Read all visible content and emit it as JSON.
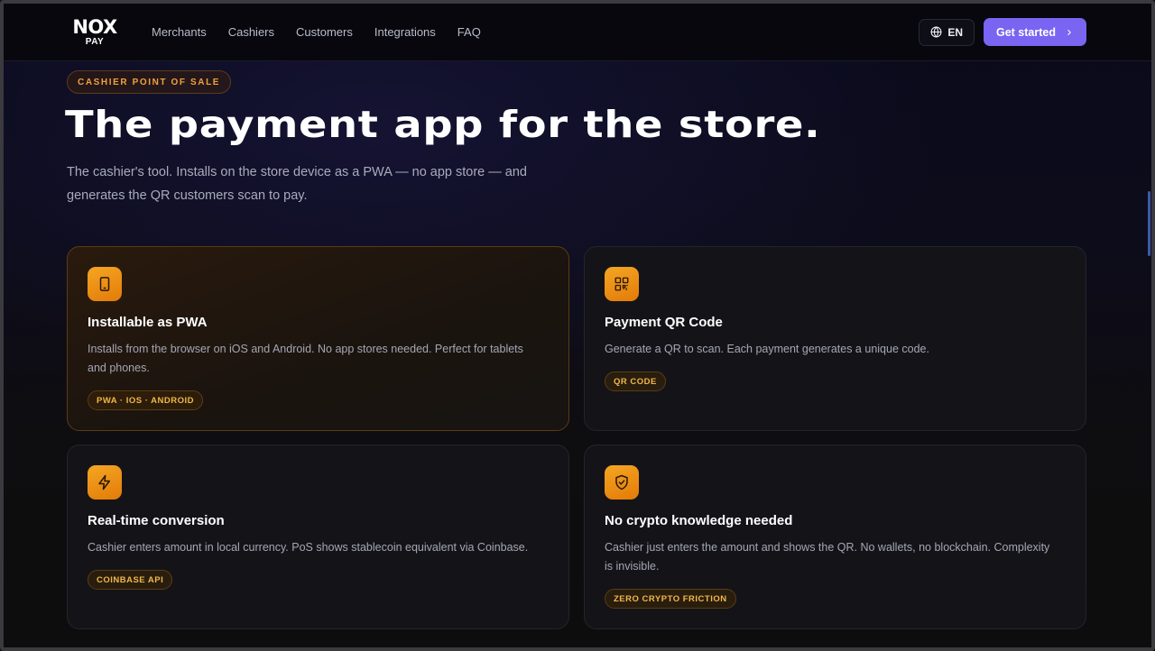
{
  "brand": {
    "logo_main": "NOX",
    "logo_sub": "PAY"
  },
  "nav": {
    "links": [
      "Merchants",
      "Cashiers",
      "Customers",
      "Integrations",
      "FAQ"
    ],
    "language": "EN",
    "cta_label": "Get started"
  },
  "hero": {
    "eyebrow": "CASHIER POINT OF SALE",
    "title": "The payment app for the store.",
    "subtitle": "The cashier's tool. Installs on the store device as a PWA — no app store — and generates the QR customers scan to pay."
  },
  "features": [
    {
      "icon": "tablet-icon",
      "title": "Installable as PWA",
      "description": "Installs from the browser on iOS and Android. No app stores needed. Perfect for tablets and phones.",
      "tag": "PWA · IOS · ANDROID"
    },
    {
      "icon": "qr-code-icon",
      "title": "Payment QR Code",
      "description": "Generate a QR to scan. Each payment generates a unique code.",
      "tag": "QR CODE"
    },
    {
      "icon": "lightning-icon",
      "title": "Real-time conversion",
      "description": "Cashier enters amount in local currency. PoS shows stablecoin equivalent via Coinbase.",
      "tag": "COINBASE API"
    },
    {
      "icon": "shield-check-icon",
      "title": "No crypto knowledge needed",
      "description": "Cashier just enters the amount and shows the QR. No wallets, no blockchain. Complexity is invisible.",
      "tag": "ZERO CRYPTO FRICTION"
    }
  ],
  "colors": {
    "accent_purple": "#7a64f2",
    "accent_orange": "#f5a623",
    "background": "#0b0b14"
  }
}
